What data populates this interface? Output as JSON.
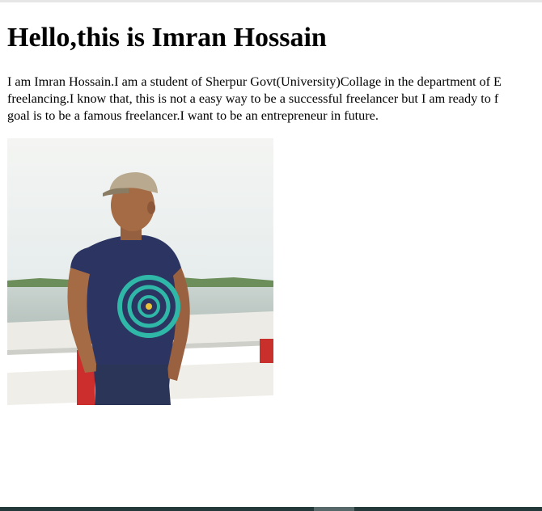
{
  "header": {
    "title": "Hello,this is Imran Hossain"
  },
  "intro": {
    "lines": [
      "I am Imran Hossain.I am a student of Sherpur Govt(University)Collage in the department of E",
      "freelancing.I know that, this is not a easy way to be a successful freelancer but I am ready to f",
      "goal is to be a famous freelancer.I want to be an entrepreneur in future."
    ]
  },
  "photo": {
    "subject": "man in cap and navy t-shirt leaning on bridge railing"
  },
  "colors": {
    "text": "#000000",
    "background": "#ffffff",
    "taskbar": "#243a3a"
  }
}
